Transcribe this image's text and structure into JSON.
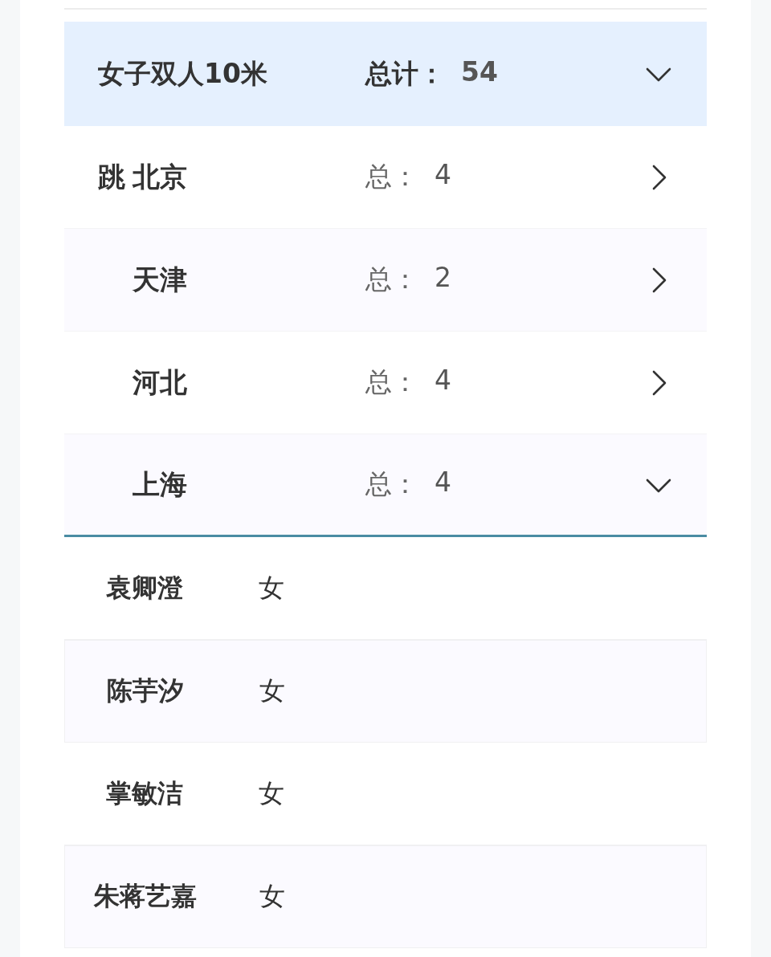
{
  "event": {
    "name": "女子双人10米",
    "total_label": "总计：",
    "total": "54",
    "expanded": true
  },
  "provinces": [
    {
      "prefix": "跳",
      "name": "北京",
      "total_label": "总：",
      "total": "4",
      "expanded": false
    },
    {
      "name": "天津",
      "total_label": "总：",
      "total": "2",
      "expanded": false
    },
    {
      "name": "河北",
      "total_label": "总：",
      "total": "4",
      "expanded": false
    },
    {
      "name": "上海",
      "total_label": "总：",
      "total": "4",
      "expanded": true,
      "athletes": [
        {
          "name": "袁卿澄",
          "gender": "女"
        },
        {
          "name": "陈芋汐",
          "gender": "女"
        },
        {
          "name": "掌敏洁",
          "gender": "女"
        },
        {
          "name": "朱蒋艺嘉",
          "gender": "女"
        }
      ]
    }
  ]
}
